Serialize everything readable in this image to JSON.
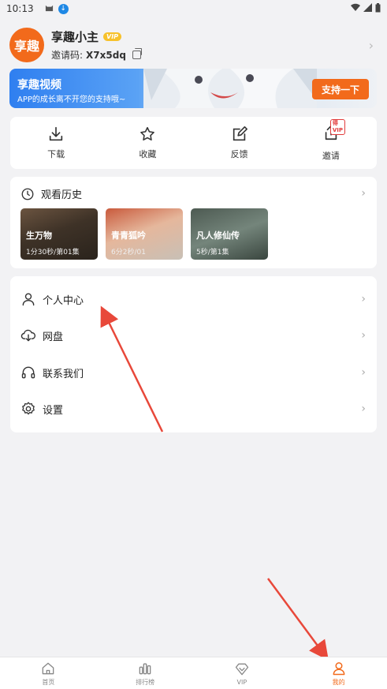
{
  "status_bar": {
    "time": "10:13"
  },
  "profile": {
    "avatar_text": "享趣",
    "name": "享趣小主",
    "vip_badge": "VIP",
    "invite_label": "邀请码:",
    "invite_code": "X7x5dq"
  },
  "banner": {
    "title": "享趣视频",
    "subtitle": "APP的成长离不开您的支持哦~",
    "button": "支持一下"
  },
  "actions": [
    {
      "label": "下载",
      "icon": "download-icon"
    },
    {
      "label": "收藏",
      "icon": "star-icon"
    },
    {
      "label": "反馈",
      "icon": "edit-icon"
    },
    {
      "label": "邀请",
      "icon": "share-icon",
      "badge": "得VIP"
    }
  ],
  "history": {
    "title": "观看历史",
    "items": [
      {
        "title": "生万物",
        "progress": "1分30秒/第01集"
      },
      {
        "title": "青青狐吟",
        "progress": "6分2秒/01"
      },
      {
        "title": "凡人修仙传",
        "progress": "5秒/第1集"
      }
    ]
  },
  "menu": [
    {
      "label": "个人中心",
      "icon": "person-icon"
    },
    {
      "label": "网盘",
      "icon": "cloud-download-icon"
    },
    {
      "label": "联系我们",
      "icon": "headset-icon"
    },
    {
      "label": "设置",
      "icon": "gear-icon"
    }
  ],
  "bottom_nav": [
    {
      "label": "首页",
      "icon": "home-icon"
    },
    {
      "label": "排行榜",
      "icon": "ranking-icon"
    },
    {
      "label": "VIP",
      "icon": "diamond-icon"
    },
    {
      "label": "我的",
      "icon": "user-icon",
      "active": true
    }
  ],
  "colors": {
    "accent": "#f26a1b",
    "arrow": "#e8483a",
    "background": "#f2f2f4"
  }
}
